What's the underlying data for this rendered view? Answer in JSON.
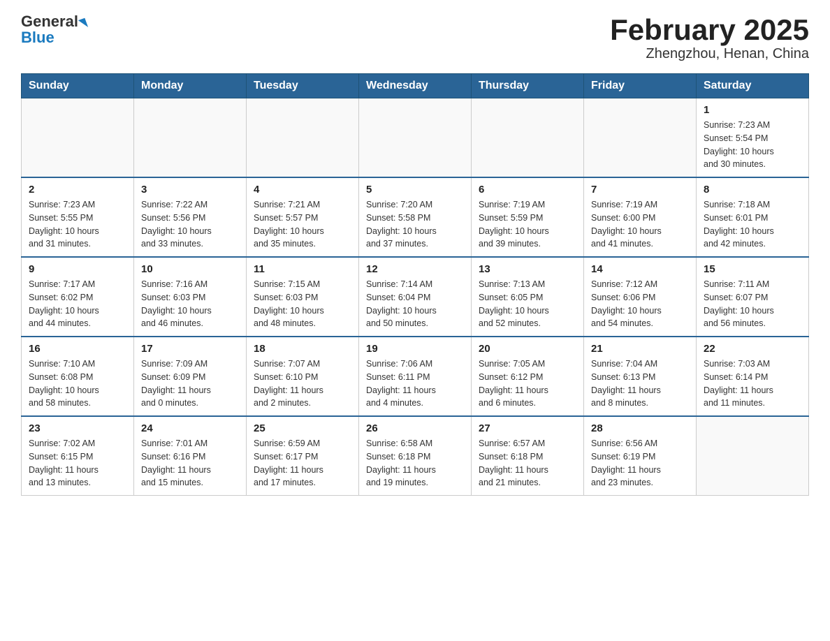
{
  "header": {
    "logo_general": "General",
    "logo_blue": "Blue",
    "month_title": "February 2025",
    "location": "Zhengzhou, Henan, China"
  },
  "days_of_week": [
    "Sunday",
    "Monday",
    "Tuesday",
    "Wednesday",
    "Thursday",
    "Friday",
    "Saturday"
  ],
  "weeks": [
    [
      {
        "day": "",
        "info": ""
      },
      {
        "day": "",
        "info": ""
      },
      {
        "day": "",
        "info": ""
      },
      {
        "day": "",
        "info": ""
      },
      {
        "day": "",
        "info": ""
      },
      {
        "day": "",
        "info": ""
      },
      {
        "day": "1",
        "info": "Sunrise: 7:23 AM\nSunset: 5:54 PM\nDaylight: 10 hours\nand 30 minutes."
      }
    ],
    [
      {
        "day": "2",
        "info": "Sunrise: 7:23 AM\nSunset: 5:55 PM\nDaylight: 10 hours\nand 31 minutes."
      },
      {
        "day": "3",
        "info": "Sunrise: 7:22 AM\nSunset: 5:56 PM\nDaylight: 10 hours\nand 33 minutes."
      },
      {
        "day": "4",
        "info": "Sunrise: 7:21 AM\nSunset: 5:57 PM\nDaylight: 10 hours\nand 35 minutes."
      },
      {
        "day": "5",
        "info": "Sunrise: 7:20 AM\nSunset: 5:58 PM\nDaylight: 10 hours\nand 37 minutes."
      },
      {
        "day": "6",
        "info": "Sunrise: 7:19 AM\nSunset: 5:59 PM\nDaylight: 10 hours\nand 39 minutes."
      },
      {
        "day": "7",
        "info": "Sunrise: 7:19 AM\nSunset: 6:00 PM\nDaylight: 10 hours\nand 41 minutes."
      },
      {
        "day": "8",
        "info": "Sunrise: 7:18 AM\nSunset: 6:01 PM\nDaylight: 10 hours\nand 42 minutes."
      }
    ],
    [
      {
        "day": "9",
        "info": "Sunrise: 7:17 AM\nSunset: 6:02 PM\nDaylight: 10 hours\nand 44 minutes."
      },
      {
        "day": "10",
        "info": "Sunrise: 7:16 AM\nSunset: 6:03 PM\nDaylight: 10 hours\nand 46 minutes."
      },
      {
        "day": "11",
        "info": "Sunrise: 7:15 AM\nSunset: 6:03 PM\nDaylight: 10 hours\nand 48 minutes."
      },
      {
        "day": "12",
        "info": "Sunrise: 7:14 AM\nSunset: 6:04 PM\nDaylight: 10 hours\nand 50 minutes."
      },
      {
        "day": "13",
        "info": "Sunrise: 7:13 AM\nSunset: 6:05 PM\nDaylight: 10 hours\nand 52 minutes."
      },
      {
        "day": "14",
        "info": "Sunrise: 7:12 AM\nSunset: 6:06 PM\nDaylight: 10 hours\nand 54 minutes."
      },
      {
        "day": "15",
        "info": "Sunrise: 7:11 AM\nSunset: 6:07 PM\nDaylight: 10 hours\nand 56 minutes."
      }
    ],
    [
      {
        "day": "16",
        "info": "Sunrise: 7:10 AM\nSunset: 6:08 PM\nDaylight: 10 hours\nand 58 minutes."
      },
      {
        "day": "17",
        "info": "Sunrise: 7:09 AM\nSunset: 6:09 PM\nDaylight: 11 hours\nand 0 minutes."
      },
      {
        "day": "18",
        "info": "Sunrise: 7:07 AM\nSunset: 6:10 PM\nDaylight: 11 hours\nand 2 minutes."
      },
      {
        "day": "19",
        "info": "Sunrise: 7:06 AM\nSunset: 6:11 PM\nDaylight: 11 hours\nand 4 minutes."
      },
      {
        "day": "20",
        "info": "Sunrise: 7:05 AM\nSunset: 6:12 PM\nDaylight: 11 hours\nand 6 minutes."
      },
      {
        "day": "21",
        "info": "Sunrise: 7:04 AM\nSunset: 6:13 PM\nDaylight: 11 hours\nand 8 minutes."
      },
      {
        "day": "22",
        "info": "Sunrise: 7:03 AM\nSunset: 6:14 PM\nDaylight: 11 hours\nand 11 minutes."
      }
    ],
    [
      {
        "day": "23",
        "info": "Sunrise: 7:02 AM\nSunset: 6:15 PM\nDaylight: 11 hours\nand 13 minutes."
      },
      {
        "day": "24",
        "info": "Sunrise: 7:01 AM\nSunset: 6:16 PM\nDaylight: 11 hours\nand 15 minutes."
      },
      {
        "day": "25",
        "info": "Sunrise: 6:59 AM\nSunset: 6:17 PM\nDaylight: 11 hours\nand 17 minutes."
      },
      {
        "day": "26",
        "info": "Sunrise: 6:58 AM\nSunset: 6:18 PM\nDaylight: 11 hours\nand 19 minutes."
      },
      {
        "day": "27",
        "info": "Sunrise: 6:57 AM\nSunset: 6:18 PM\nDaylight: 11 hours\nand 21 minutes."
      },
      {
        "day": "28",
        "info": "Sunrise: 6:56 AM\nSunset: 6:19 PM\nDaylight: 11 hours\nand 23 minutes."
      },
      {
        "day": "",
        "info": ""
      }
    ]
  ]
}
